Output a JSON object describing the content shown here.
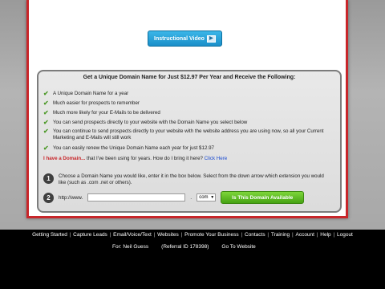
{
  "video_button": {
    "label": "Instructional Video",
    "icon": "video-camera-icon"
  },
  "headline": "Get a Unique Domain Name for Just $12.97 Per Year and Receive the Following:",
  "benefits": [
    "A Unique Domain Name for a year",
    "Much easier for prospects to remember",
    "Much more likely for your E-Mails to be delivered",
    "You can send prospects directly to your website with the Domain Name you select below",
    "You can continue to send prospects directly to your website with the website address you are using now, so all your Current Marketing and E-Mails will still work",
    "You can easily renew the Unique Domain Name each year for just $12.97"
  ],
  "have_domain": {
    "lead": "I have a Domain...",
    "text": " that I've been using for years. How do I bring it here? ",
    "link": "Click Here"
  },
  "step1": {
    "number": "1",
    "text": "Choose a Domain Name you would like, enter it in the box below. Select from the down arrow which extension you would like (such as .com .net or others)."
  },
  "step2": {
    "number": "2",
    "prefix": "http://www.",
    "input_value": "",
    "separator": ".",
    "tld_selected": "com",
    "button_label": "Is This Domain Available"
  },
  "footer_nav": [
    "Getting Started",
    "Capture Leads",
    "Email/Voice/Text",
    "Websites",
    "Promote Your Business",
    "Contacts",
    "Training",
    "Account",
    "Help",
    "Logout"
  ],
  "footer_info": {
    "for_label": "For: Neil Guess",
    "referral": "(Referral ID 178398)",
    "goto": "Go To Website"
  },
  "colors": {
    "accent_red": "#c8262a",
    "button_blue": "#1a8fc9",
    "button_green": "#46a313",
    "check_green": "#4e9a2a"
  }
}
